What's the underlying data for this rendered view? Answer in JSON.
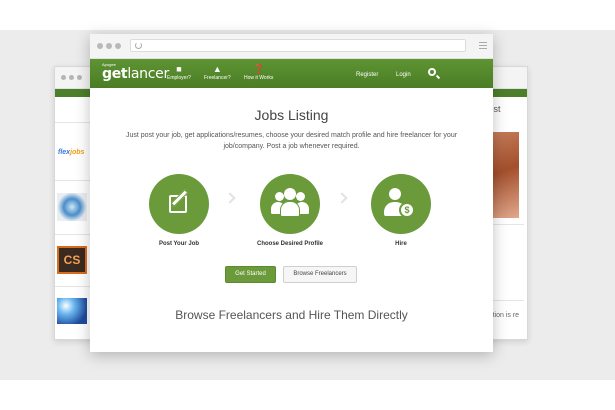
{
  "browser": {
    "menu_icon": "hamburger-menu-icon",
    "reload_icon": "reload-icon"
  },
  "back_window": {
    "right_heading": "west",
    "right_footer": "isition is re",
    "logo_text": {
      "part1": "flex",
      "part2": "jobs"
    },
    "thumb_badge": "CS"
  },
  "navbar": {
    "brand_small": "Apogee",
    "brand_prefix": "get",
    "brand_suffix": "lancer",
    "items": [
      {
        "label": "Employer?",
        "icon": "briefcase-icon"
      },
      {
        "label": "Freelancer?",
        "icon": "user-icon"
      },
      {
        "label": "How it Works",
        "icon": "question-icon"
      }
    ],
    "register_label": "Register",
    "login_label": "Login",
    "search_icon": "search-icon"
  },
  "main": {
    "title": "Jobs Listing",
    "description": "Just post your job, get applications/resumes, choose your desired match profile and hire freelancer for your job/company. Post a job whenever required.",
    "steps": [
      {
        "label": "Post Your Job",
        "icon": "edit-icon"
      },
      {
        "label": "Choose Desired Profile",
        "icon": "users-icon"
      },
      {
        "label": "Hire",
        "icon": "hire-money-icon"
      }
    ],
    "get_started_label": "Get Started",
    "browse_label": "Browse Freelancers",
    "subtitle": "Browse Freelancers and Hire Them Directly"
  },
  "colors": {
    "brand_green": "#5b8f2f",
    "step_green": "#6b9a3a",
    "background": "#ececec"
  }
}
